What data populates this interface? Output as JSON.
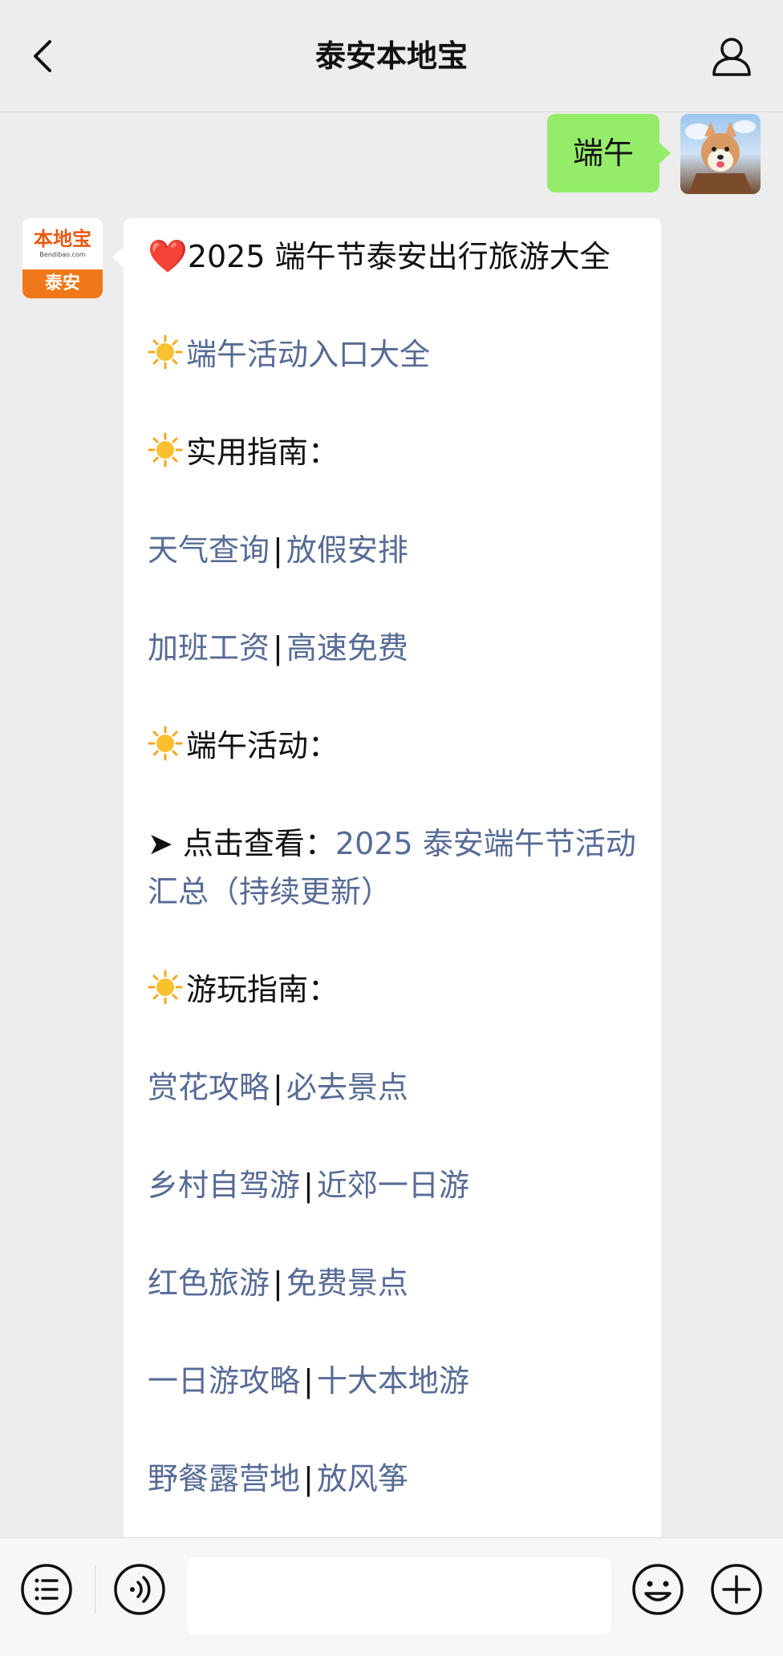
{
  "header": {
    "title": "泰安本地宝"
  },
  "outgoing": {
    "text": "端午"
  },
  "incoming": {
    "avatar": {
      "brand": "本地宝",
      "site": "Bendibao.com",
      "city": "泰安"
    },
    "heading": {
      "emoji": "❤️",
      "text": "2025 端午节泰安出行旅游大全"
    },
    "entry_link": "端午活动入口大全",
    "guide_title": "实用指南：",
    "guide_row1": [
      "天气查询",
      "放假安排"
    ],
    "guide_row2": [
      "加班工资",
      "高速免费"
    ],
    "activities_title": "端午活动：",
    "activities_prefix": "➤ 点击查看：",
    "activities_link": "2025 泰安端午节活动汇总（持续更新）",
    "play_title": "游玩指南：",
    "play_rows": [
      [
        "赏花攻略",
        "必去景点"
      ],
      [
        "乡村自驾游",
        "近郊一日游"
      ],
      [
        "红色旅游",
        "免费景点"
      ],
      [
        "一日游攻略",
        "十大本地游"
      ],
      [
        "野餐露营地",
        "放风筝"
      ]
    ],
    "separator": "|"
  },
  "input": {
    "placeholder": ""
  },
  "colors": {
    "link": "#576b95",
    "outgoing_bubble": "#95ec69",
    "background": "#ededed"
  },
  "icons": [
    "back-arrow-icon",
    "profile-icon",
    "menu-list-icon",
    "voice-icon",
    "emoji-icon",
    "plus-icon",
    "sun-icon",
    "heart-icon"
  ]
}
